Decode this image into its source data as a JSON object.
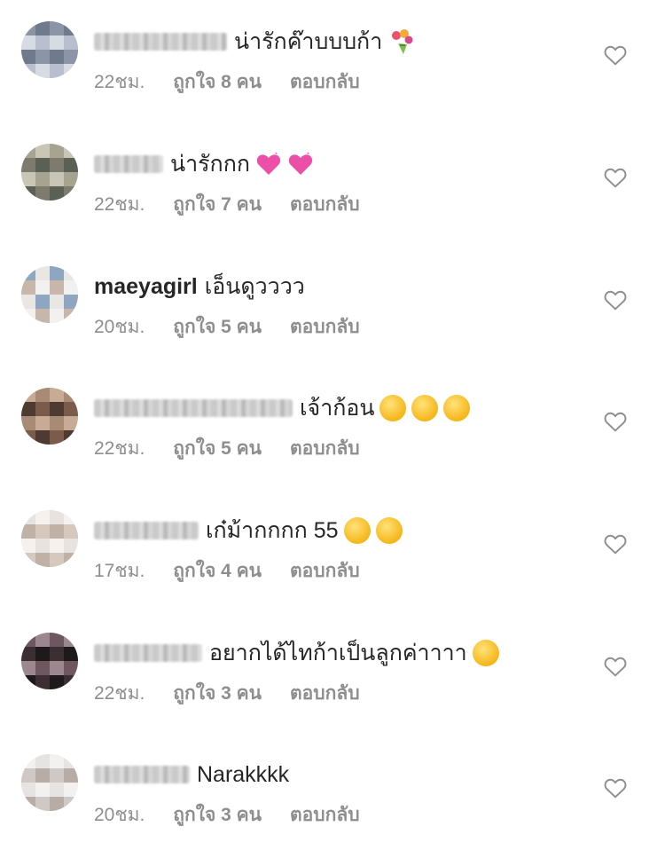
{
  "comments": [
    {
      "username": "",
      "blurred": true,
      "blur_w": 150,
      "text": "น่ารักค๊าบบบก้า",
      "emoji": [
        "bouquet"
      ],
      "time": "22ชม.",
      "likes": "ถูกใจ 8 คน",
      "reply": "ตอบกลับ",
      "avatar_palette": [
        "#8c95a6",
        "#b9bfcf",
        "#6f7a8c",
        "#d7dbe3"
      ]
    },
    {
      "username": "",
      "blurred": true,
      "blur_w": 78,
      "text": "น่ารักกก",
      "emoji": [
        "heart",
        "heart"
      ],
      "time": "22ชม.",
      "likes": "ถูกใจ 7 คน",
      "reply": "ตอบกลับ",
      "avatar_palette": [
        "#7d7a6e",
        "#a6a391",
        "#5b6054",
        "#c9c5b7"
      ]
    },
    {
      "username": "maeyagirl",
      "blurred": false,
      "text": "เอ็นดูวววว",
      "emoji": [],
      "time": "20ชม.",
      "likes": "ถูกใจ 5 คน",
      "reply": "ตอบกลับ",
      "avatar_palette": [
        "#e9e6e3",
        "#c7b7ab",
        "#8fa6c1",
        "#f3f1ef"
      ]
    },
    {
      "username": "",
      "blurred": true,
      "blur_w": 224,
      "text": "เจ้าก้อน",
      "emoji": [
        "yellow",
        "yellow",
        "yellow"
      ],
      "time": "22ชม.",
      "likes": "ถูกใจ 5 คน",
      "reply": "ตอบกลับ",
      "avatar_palette": [
        "#7b5b4b",
        "#a98a76",
        "#4e3a31",
        "#c8ab95"
      ]
    },
    {
      "username": "",
      "blurred": true,
      "blur_w": 118,
      "text": "เก๋ม้ากกกก 55",
      "emoji": [
        "yellow",
        "yellow"
      ],
      "time": "17ชม.",
      "likes": "ถูกใจ 4 คน",
      "reply": "ตอบกลับ",
      "avatar_palette": [
        "#e8e3df",
        "#d4c8bf",
        "#f4f1ee",
        "#bfb1a6"
      ]
    },
    {
      "username": "",
      "blurred": true,
      "blur_w": 122,
      "text": "อยากได้ไทก้าเป็นลูกค่าาาา",
      "emoji": [
        "yellow"
      ],
      "time": "22ชม.",
      "likes": "ถูกใจ 3 คน",
      "reply": "ตอบกลับ",
      "avatar_palette": [
        "#3b2f32",
        "#6d5860",
        "#1e1a1c",
        "#9a8790"
      ]
    },
    {
      "username": "",
      "blurred": true,
      "blur_w": 108,
      "text": "Narakkkk",
      "emoji": [],
      "time": "20ชม.",
      "likes": "ถูกใจ 3 คน",
      "reply": "ตอบกลับ",
      "avatar_palette": [
        "#e6e4e3",
        "#cfc8c4",
        "#f2f1f0",
        "#b8aca6"
      ]
    }
  ]
}
